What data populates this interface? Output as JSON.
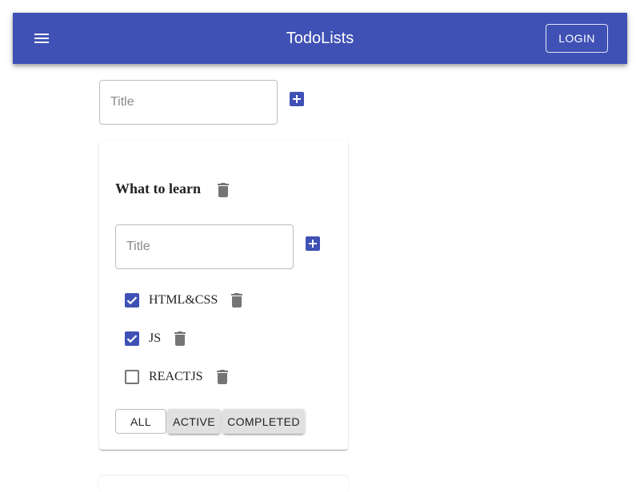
{
  "header": {
    "title": "TodoLists",
    "menu_icon": "menu-icon",
    "login_label": "LOGIN",
    "color": "#3f51b5"
  },
  "new_list": {
    "placeholder": "Title",
    "value": "",
    "add_icon": "add-box-icon"
  },
  "todolists": [
    {
      "title": "What to learn",
      "delete_icon": "delete-icon",
      "new_task": {
        "placeholder": "Title",
        "value": "",
        "add_icon": "add-box-icon"
      },
      "tasks": [
        {
          "title": "HTML&CSS",
          "done": true
        },
        {
          "title": "JS",
          "done": true
        },
        {
          "title": "REACTJS",
          "done": false
        }
      ],
      "filters": [
        {
          "label": "ALL",
          "selected": true
        },
        {
          "label": "ACTIVE",
          "selected": false
        },
        {
          "label": "COMPLETED",
          "selected": false
        }
      ]
    }
  ],
  "colors": {
    "primary": "#3f51b5",
    "icon_gray": "#757575",
    "button_gray": "#e0e0e0"
  }
}
